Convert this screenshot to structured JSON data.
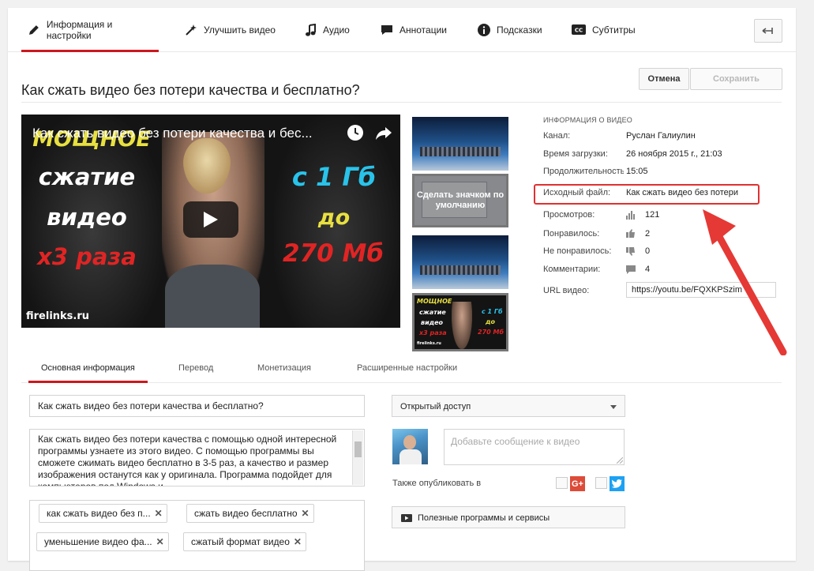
{
  "nav": {
    "tabs": [
      {
        "label": "Информация и настройки",
        "icon": "pencil-icon"
      },
      {
        "label": "Улучшить видео",
        "icon": "magic-wand-icon"
      },
      {
        "label": "Аудио",
        "icon": "music-note-icon"
      },
      {
        "label": "Аннотации",
        "icon": "speech-bubble-icon"
      },
      {
        "label": "Подсказки",
        "icon": "info-icon"
      },
      {
        "label": "Субтитры",
        "icon": "cc-icon"
      }
    ],
    "active_tab": 0,
    "back_icon": "back-arrow-icon"
  },
  "video_title": "Как сжать видео без потери качества и бесплатно?",
  "buttons": {
    "cancel": "Отмена",
    "save": "Сохранить"
  },
  "player": {
    "title": "Как сжать видео без потери качества и бес...",
    "overlay": {
      "line1": "МОЩНОЕ",
      "line2": "сжатие",
      "line3": "видео",
      "line4": "x3 раза",
      "right1": "с 1 Гб",
      "right2": "до",
      "right3": "270 Мб",
      "site": "firelinks.ru"
    }
  },
  "thumbnails": {
    "make_default_label": "Сделать значком по умолчанию",
    "mini_overlay": {
      "line1": "МОЩНОЕ",
      "line2": "сжатие",
      "line3": "видео",
      "line4": "x3 раза",
      "right1": "с 1 Гб",
      "right2": "до",
      "right3": "270 Мб",
      "site": "firelinks.ru"
    }
  },
  "info": {
    "header": "ИНФОРМАЦИЯ О ВИДЕО",
    "channel_label": "Канал:",
    "channel": "Руслан Галиулин",
    "upload_label": "Время загрузки:",
    "upload_date": "26 ноября 2015 г., 21:03",
    "duration_label": "Продолжительность:",
    "duration": "15:05",
    "source_label": "Исходный файл:",
    "source_file": "Как сжать видео без потери",
    "views_label": "Просмотров:",
    "views": "121",
    "likes_label": "Понравилось:",
    "likes": "2",
    "dislikes_label": "Не понравилось:",
    "dislikes": "0",
    "comments_label": "Комментарии:",
    "comments": "4",
    "url_label": "URL видео:",
    "url": "https://youtu.be/FQXKPSzim"
  },
  "subtabs": [
    "Основная информация",
    "Перевод",
    "Монетизация",
    "Расширенные настройки"
  ],
  "form": {
    "title_value": "Как сжать видео без потери качества и бесплатно?",
    "description": "Как сжать видео без потери качества с помощью одной интересной программы узнаете из этого видео. С помощью программы вы сможете сжимать видео бесплатно в 3-5 раз, а качество и размер изображения останутся как у оригинала. Программа подойдет для компьютеров под Windows и",
    "tags": [
      "как сжать видео без п...",
      "сжать видео бесплатно",
      "уменьшение видео фа...",
      "сжатый формат видео"
    ],
    "privacy": "Открытый доступ",
    "message_placeholder": "Добавьте сообщение к видео",
    "also_publish": "Также опубликовать в",
    "gplus_label": "G+",
    "playlist": "Полезные программы и сервисы"
  },
  "colors": {
    "accent": "#cc181e",
    "callout": "#e03131",
    "twitter": "#1da1f2",
    "gplus": "#dd4b39"
  }
}
